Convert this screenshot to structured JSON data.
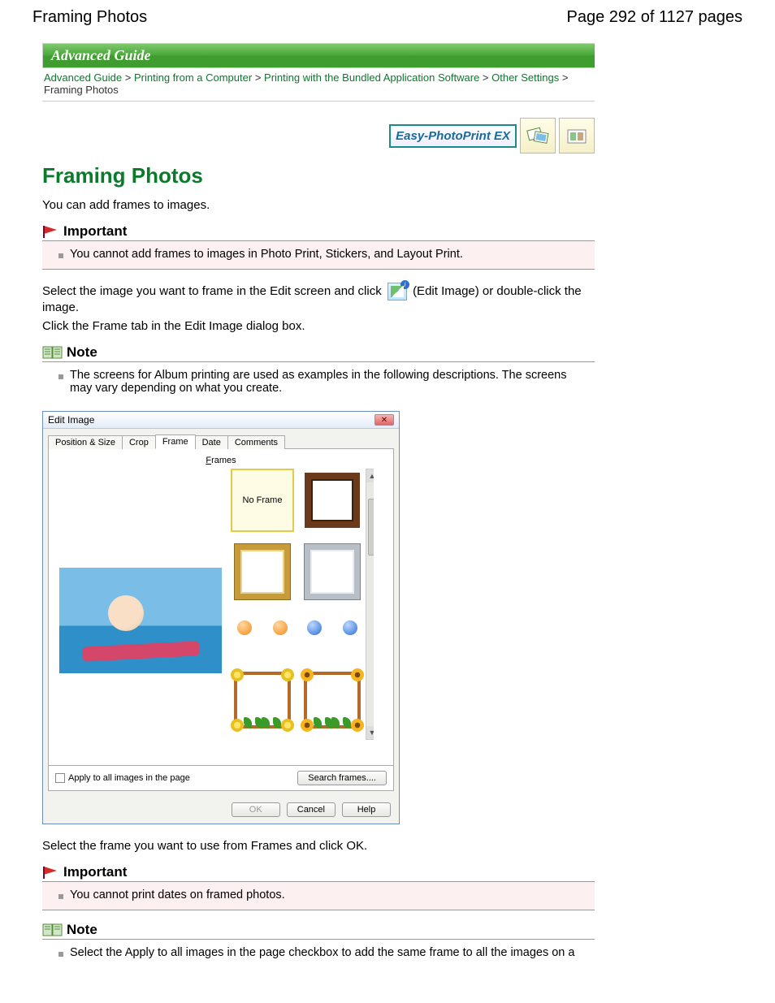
{
  "header": {
    "title": "Framing Photos",
    "page_label": "Page 292 of 1127 pages"
  },
  "banner": {
    "title": "Advanced Guide"
  },
  "breadcrumb": {
    "items": [
      {
        "label": "Advanced Guide",
        "link": true
      },
      {
        "label": "Printing from a Computer",
        "link": true
      },
      {
        "label": "Printing with the Bundled Application Software",
        "link": true
      },
      {
        "label": "Other Settings",
        "link": true
      },
      {
        "label": "Framing Photos",
        "link": false
      }
    ],
    "sep": ">"
  },
  "app_badge": {
    "name": "Easy-PhotoPrint EX"
  },
  "topic": {
    "title": "Framing Photos",
    "intro": "You can add frames to images."
  },
  "important1": {
    "label": "Important",
    "items": [
      "You cannot add frames to images in Photo Print, Stickers, and Layout Print."
    ]
  },
  "step1": {
    "pre": "Select the image you want to frame in the Edit screen and click ",
    "post": " (Edit Image) or double-click the image."
  },
  "step2": "Click the Frame tab in the Edit Image dialog box.",
  "note1": {
    "label": "Note",
    "items": [
      "The screens for Album printing are used as examples in the following descriptions. The screens may vary depending on what you create."
    ]
  },
  "dialog": {
    "title": "Edit Image",
    "tabs": [
      "Position & Size",
      "Crop",
      "Frame",
      "Date",
      "Comments"
    ],
    "active_tab": "Frame",
    "frames_label_u": "F",
    "frames_label_rest": "rames",
    "no_frame": "No Frame",
    "apply_all": "Apply to all images in the page",
    "search_frames": "Search frames....",
    "buttons": {
      "ok": "OK",
      "cancel": "Cancel",
      "help": "Help"
    }
  },
  "after_dialog": "Select the frame you want to use from Frames and click OK.",
  "important2": {
    "label": "Important",
    "items": [
      "You cannot print dates on framed photos."
    ]
  },
  "note2": {
    "label": "Note",
    "items": [
      "Select the Apply to all images in the page checkbox to add the same frame to all the images on a"
    ]
  }
}
